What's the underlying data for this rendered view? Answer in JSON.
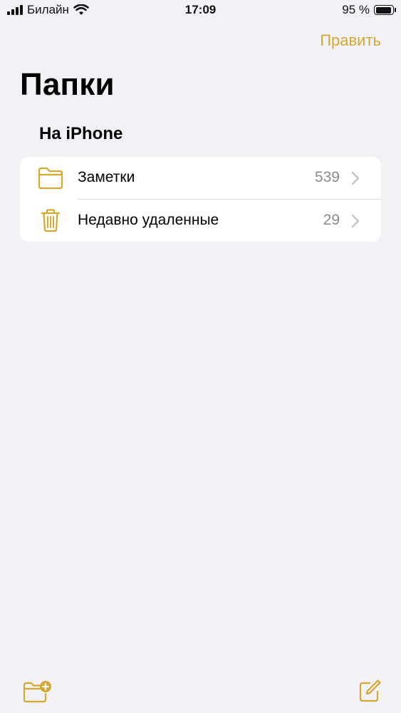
{
  "status_bar": {
    "carrier": "Билайн",
    "time": "17:09",
    "battery_text": "95 %",
    "battery_level": 0.95,
    "icons": [
      "cellular-signal-icon",
      "wifi-icon",
      "battery-icon"
    ]
  },
  "nav": {
    "edit_label": "Править",
    "title": "Папки"
  },
  "section": {
    "title": "На iPhone"
  },
  "folders": [
    {
      "label": "Заметки",
      "count": "539",
      "icon": "folder-icon"
    },
    {
      "label": "Недавно удаленные",
      "count": "29",
      "icon": "trash-icon"
    }
  ],
  "toolbar": {
    "left_icon": "new-folder-icon",
    "right_icon": "compose-icon"
  },
  "colors": {
    "accent": "#d5a82f",
    "background": "#f2f1f6",
    "card": "#ffffff",
    "secondary_text": "#8a8a8e"
  }
}
